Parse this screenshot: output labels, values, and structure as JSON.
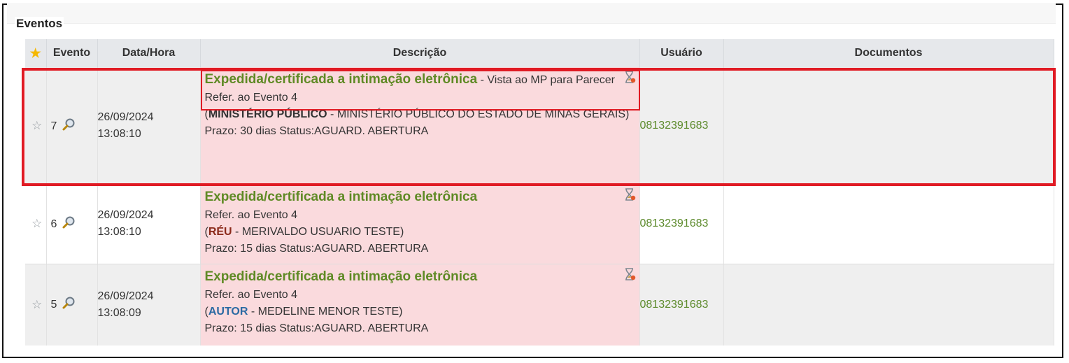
{
  "section": {
    "title": "Eventos"
  },
  "table": {
    "headers": {
      "star": "★",
      "evento": "Evento",
      "datahora": "Data/Hora",
      "descricao": "Descrição",
      "usuario": "Usuário",
      "documentos": "Documentos"
    },
    "rows": [
      {
        "evento": "7",
        "date": "26/09/2024",
        "time": "13:08:10",
        "title": "Expedida/certificada a intimação eletrônica",
        "title_suffix": " - Vista ao MP para Parecer",
        "refer": "Refer. ao Evento 4",
        "role": "MINISTÉRIO PÚBLICO",
        "party": " - MINISTÉRIO PÚBLICO DO ESTADO DE MINAS GERAIS)",
        "prazo": "Prazo: 30 dias Status:AGUARD. ABERTURA",
        "user": "08132391683",
        "documentos": ""
      },
      {
        "evento": "6",
        "date": "26/09/2024",
        "time": "13:08:10",
        "title": "Expedida/certificada a intimação eletrônica",
        "title_suffix": "",
        "refer": "Refer. ao Evento 4",
        "role": "RÉU",
        "party": " - MERIVALDO USUARIO TESTE)",
        "prazo": "Prazo: 15 dias Status:AGUARD. ABERTURA",
        "user": "08132391683",
        "documentos": ""
      },
      {
        "evento": "5",
        "date": "26/09/2024",
        "time": "13:08:09",
        "title": "Expedida/certificada a intimação eletrônica",
        "title_suffix": "",
        "refer": "Refer. ao Evento 4",
        "role": "AUTOR",
        "party": " - MEDELINE MENOR TESTE)",
        "prazo": "Prazo: 15 dias Status:AGUARD. ABERTURA",
        "user": "08132391683",
        "documentos": ""
      }
    ]
  },
  "icons": {
    "star": "star-outline-icon",
    "magnifier": "magnifier-icon",
    "hourglass": "hourglass-icon"
  },
  "colors": {
    "highlight": "#e01b24",
    "title_green": "#5f8a25",
    "desc_bg": "#fadadd",
    "header_bg": "#e6e8eb",
    "role_reu": "#8b2a1a",
    "role_autor": "#2b6aa3"
  }
}
